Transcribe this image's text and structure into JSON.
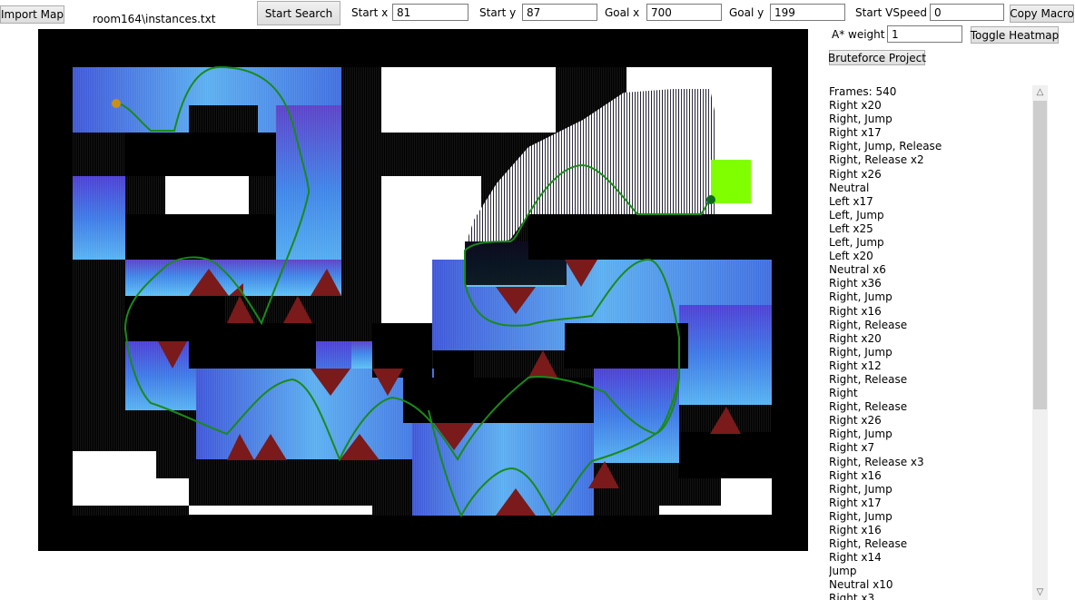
{
  "toolbar": {
    "import_label": "Import Map",
    "file_path": "room164\\instances.txt",
    "start_search_label": "Start Search",
    "start_x_label": "Start x",
    "start_x_value": "81",
    "start_y_label": "Start y",
    "start_y_value": "87",
    "goal_x_label": "Goal x",
    "goal_x_value": "700",
    "goal_y_label": "Goal y",
    "goal_y_value": "199",
    "start_vspeed_label": "Start VSpeed",
    "start_vspeed_value": "0",
    "copy_macro_label": "Copy Macro",
    "astar_weight_label": "A* weight",
    "astar_weight_value": "1",
    "toggle_heatmap_label": "Toggle Heatmap",
    "bruteforce_label": "Bruteforce Project"
  },
  "macro_list": [
    "Frames: 540",
    "Right x20",
    "Right, Jump",
    "Right x17",
    "Right, Jump, Release",
    "Right, Release x2",
    "Right x26",
    "Neutral",
    "Left x17",
    "Left, Jump",
    "Left x25",
    "Left, Jump",
    "Left x20",
    "Neutral x6",
    "Right x36",
    "Right, Jump",
    "Right x16",
    "Right, Release",
    "Right x20",
    "Right, Jump",
    "Right x12",
    "Right, Release",
    "Right",
    "Right, Release",
    "Right x26",
    "Right, Jump",
    "Right x7",
    "Right, Release x3",
    "Right x16",
    "Right, Jump",
    "Right x17",
    "Right, Jump",
    "Right x16",
    "Right, Release",
    "Right x14",
    "Jump",
    "Neutral x10",
    "Right x3"
  ],
  "colors": {
    "wall": "#000000",
    "empty": "#ffffff",
    "spike": "#7a1a1a",
    "path": "#1a8a1a",
    "goal": "#80ff00",
    "start_marker": "#c8901a",
    "heat_low": "#4a3fd0",
    "heat_high": "#5ab0f0"
  },
  "icons": {
    "scroll_up": "chevron-up-icon",
    "scroll_down": "chevron-down-icon"
  }
}
